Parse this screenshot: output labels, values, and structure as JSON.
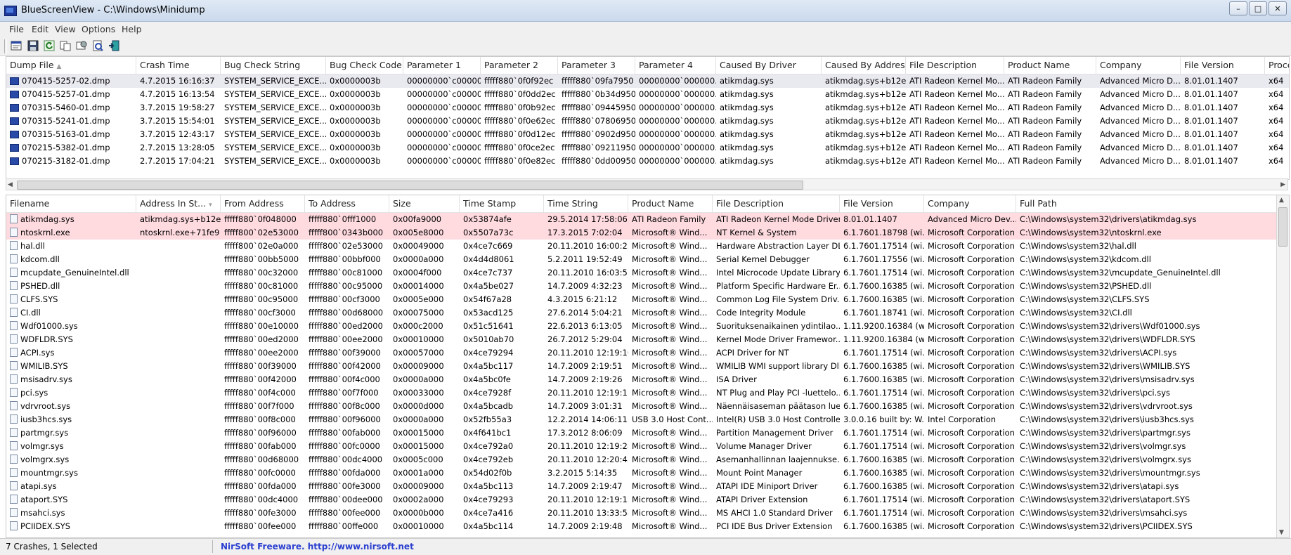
{
  "window": {
    "title": "BlueScreenView  -  C:\\Windows\\Minidump"
  },
  "menu": [
    "File",
    "Edit",
    "View",
    "Options",
    "Help"
  ],
  "toolbar": [
    "properties-icon",
    "save-icon",
    "refresh-icon",
    "copy-icon",
    "options-icon",
    "report-icon",
    "exit-icon"
  ],
  "top": {
    "columns": [
      "Dump File",
      "Crash Time",
      "Bug Check String",
      "Bug Check Code",
      "Parameter 1",
      "Parameter 2",
      "Parameter 3",
      "Parameter 4",
      "Caused By Driver",
      "Caused By Address",
      "File Description",
      "Product Name",
      "Company",
      "File Version",
      "Processor"
    ],
    "rows": [
      [
        "070415-5257-02.dmp",
        "4.7.2015 16:16:37",
        "SYSTEM_SERVICE_EXCE...",
        "0x0000003b",
        "00000000`c00000...",
        "fffff880`0f0f92ec",
        "fffff880`09fa7950",
        "00000000`000000...",
        "atikmdag.sys",
        "atikmdag.sys+b12ec",
        "ATI Radeon Kernel Mo...",
        "ATI Radeon Family",
        "Advanced Micro D...",
        "8.01.01.1407",
        "x64"
      ],
      [
        "070415-5257-01.dmp",
        "4.7.2015 16:13:54",
        "SYSTEM_SERVICE_EXCE...",
        "0x0000003b",
        "00000000`c00000...",
        "fffff880`0f0dd2ec",
        "fffff880`0b34d950",
        "00000000`000000...",
        "atikmdag.sys",
        "atikmdag.sys+b12ec",
        "ATI Radeon Kernel Mo...",
        "ATI Radeon Family",
        "Advanced Micro D...",
        "8.01.01.1407",
        "x64"
      ],
      [
        "070315-5460-01.dmp",
        "3.7.2015 19:58:27",
        "SYSTEM_SERVICE_EXCE...",
        "0x0000003b",
        "00000000`c00000...",
        "fffff880`0f0b92ec",
        "fffff880`09445950",
        "00000000`000000...",
        "atikmdag.sys",
        "atikmdag.sys+b12ec",
        "ATI Radeon Kernel Mo...",
        "ATI Radeon Family",
        "Advanced Micro D...",
        "8.01.01.1407",
        "x64"
      ],
      [
        "070315-5241-01.dmp",
        "3.7.2015 15:54:01",
        "SYSTEM_SERVICE_EXCE...",
        "0x0000003b",
        "00000000`c00000...",
        "fffff880`0f0e62ec",
        "fffff880`07806950",
        "00000000`000000...",
        "atikmdag.sys",
        "atikmdag.sys+b12ec",
        "ATI Radeon Kernel Mo...",
        "ATI Radeon Family",
        "Advanced Micro D...",
        "8.01.01.1407",
        "x64"
      ],
      [
        "070315-5163-01.dmp",
        "3.7.2015 12:43:17",
        "SYSTEM_SERVICE_EXCE...",
        "0x0000003b",
        "00000000`c00000...",
        "fffff880`0f0d12ec",
        "fffff880`0902d950",
        "00000000`000000...",
        "atikmdag.sys",
        "atikmdag.sys+b12ec",
        "ATI Radeon Kernel Mo...",
        "ATI Radeon Family",
        "Advanced Micro D...",
        "8.01.01.1407",
        "x64"
      ],
      [
        "070215-5382-01.dmp",
        "2.7.2015 13:28:05",
        "SYSTEM_SERVICE_EXCE...",
        "0x0000003b",
        "00000000`c00000...",
        "fffff880`0f0ce2ec",
        "fffff880`09211950",
        "00000000`000000...",
        "atikmdag.sys",
        "atikmdag.sys+b12ec",
        "ATI Radeon Kernel Mo...",
        "ATI Radeon Family",
        "Advanced Micro D...",
        "8.01.01.1407",
        "x64"
      ],
      [
        "070215-3182-01.dmp",
        "2.7.2015 17:04:21",
        "SYSTEM_SERVICE_EXCE...",
        "0x0000003b",
        "00000000`c00000...",
        "fffff880`0f0e82ec",
        "fffff880`0dd00950",
        "00000000`000000...",
        "atikmdag.sys",
        "atikmdag.sys+b12ec",
        "ATI Radeon Kernel Mo...",
        "ATI Radeon Family",
        "Advanced Micro D...",
        "8.01.01.1407",
        "x64"
      ]
    ]
  },
  "bottom": {
    "columns": [
      "Filename",
      "Address In St...",
      "From Address",
      "To Address",
      "Size",
      "Time Stamp",
      "Time String",
      "Product Name",
      "File Description",
      "File Version",
      "Company",
      "Full Path"
    ],
    "rows": [
      [
        "atikmdag.sys",
        "atikmdag.sys+b12ec",
        "fffff880`0f048000",
        "fffff880`0fff1000",
        "0x00fa9000",
        "0x53874afe",
        "29.5.2014 17:58:06",
        "ATI Radeon Family",
        "ATI Radeon Kernel Mode Driver",
        "8.01.01.1407",
        "Advanced Micro Dev...",
        "C:\\Windows\\system32\\drivers\\atikmdag.sys"
      ],
      [
        "ntoskrnl.exe",
        "ntoskrnl.exe+71fe9",
        "fffff800`02e53000",
        "fffff800`0343b000",
        "0x005e8000",
        "0x5507a73c",
        "17.3.2015 7:02:04",
        "Microsoft® Wind...",
        "NT Kernel & System",
        "6.1.7601.18798 (wi...",
        "Microsoft Corporation",
        "C:\\Windows\\system32\\ntoskrnl.exe"
      ],
      [
        "hal.dll",
        "",
        "fffff800`02e0a000",
        "fffff800`02e53000",
        "0x00049000",
        "0x4ce7c669",
        "20.11.2010 16:00:25",
        "Microsoft® Wind...",
        "Hardware Abstraction Layer DLL",
        "6.1.7601.17514 (wi...",
        "Microsoft Corporation",
        "C:\\Windows\\system32\\hal.dll"
      ],
      [
        "kdcom.dll",
        "",
        "fffff880`00bb5000",
        "fffff880`00bbf000",
        "0x0000a000",
        "0x4d4d8061",
        "5.2.2011 19:52:49",
        "Microsoft® Wind...",
        "Serial Kernel Debugger",
        "6.1.7601.17556 (wi...",
        "Microsoft Corporation",
        "C:\\Windows\\system32\\kdcom.dll"
      ],
      [
        "mcupdate_GenuineIntel.dll",
        "",
        "fffff880`00c32000",
        "fffff880`00c81000",
        "0x0004f000",
        "0x4ce7c737",
        "20.11.2010 16:03:51",
        "Microsoft® Wind...",
        "Intel Microcode Update Library",
        "6.1.7601.17514 (wi...",
        "Microsoft Corporation",
        "C:\\Windows\\system32\\mcupdate_GenuineIntel.dll"
      ],
      [
        "PSHED.dll",
        "",
        "fffff880`00c81000",
        "fffff880`00c95000",
        "0x00014000",
        "0x4a5be027",
        "14.7.2009 4:32:23",
        "Microsoft® Wind...",
        "Platform Specific Hardware Er...",
        "6.1.7600.16385 (wi...",
        "Microsoft Corporation",
        "C:\\Windows\\system32\\PSHED.dll"
      ],
      [
        "CLFS.SYS",
        "",
        "fffff880`00c95000",
        "fffff880`00cf3000",
        "0x0005e000",
        "0x54f67a28",
        "4.3.2015 6:21:12",
        "Microsoft® Wind...",
        "Common Log File System Driv...",
        "6.1.7600.16385 (wi...",
        "Microsoft Corporation",
        "C:\\Windows\\system32\\CLFS.SYS"
      ],
      [
        "CI.dll",
        "",
        "fffff880`00cf3000",
        "fffff880`00d68000",
        "0x00075000",
        "0x53acd125",
        "27.6.2014 5:04:21",
        "Microsoft® Wind...",
        "Code Integrity Module",
        "6.1.7601.18741 (wi...",
        "Microsoft Corporation",
        "C:\\Windows\\system32\\CI.dll"
      ],
      [
        "Wdf01000.sys",
        "",
        "fffff880`00e10000",
        "fffff880`00ed2000",
        "0x000c2000",
        "0x51c51641",
        "22.6.2013 6:13:05",
        "Microsoft® Wind...",
        "Suorituksenaikainen ydintilao...",
        "1.11.9200.16384 (w...",
        "Microsoft Corporation",
        "C:\\Windows\\system32\\drivers\\Wdf01000.sys"
      ],
      [
        "WDFLDR.SYS",
        "",
        "fffff880`00ed2000",
        "fffff880`00ee2000",
        "0x00010000",
        "0x5010ab70",
        "26.7.2012 5:29:04",
        "Microsoft® Wind...",
        "Kernel Mode Driver Framewor...",
        "1.11.9200.16384 (w...",
        "Microsoft Corporation",
        "C:\\Windows\\system32\\drivers\\WDFLDR.SYS"
      ],
      [
        "ACPI.sys",
        "",
        "fffff880`00ee2000",
        "fffff880`00f39000",
        "0x00057000",
        "0x4ce79294",
        "20.11.2010 12:19:16",
        "Microsoft® Wind...",
        "ACPI Driver for NT",
        "6.1.7601.17514 (wi...",
        "Microsoft Corporation",
        "C:\\Windows\\system32\\drivers\\ACPI.sys"
      ],
      [
        "WMILIB.SYS",
        "",
        "fffff880`00f39000",
        "fffff880`00f42000",
        "0x00009000",
        "0x4a5bc117",
        "14.7.2009 2:19:51",
        "Microsoft® Wind...",
        "WMILIB WMI support library Dll",
        "6.1.7600.16385 (wi...",
        "Microsoft Corporation",
        "C:\\Windows\\system32\\drivers\\WMILIB.SYS"
      ],
      [
        "msisadrv.sys",
        "",
        "fffff880`00f42000",
        "fffff880`00f4c000",
        "0x0000a000",
        "0x4a5bc0fe",
        "14.7.2009 2:19:26",
        "Microsoft® Wind...",
        "ISA Driver",
        "6.1.7600.16385 (wi...",
        "Microsoft Corporation",
        "C:\\Windows\\system32\\drivers\\msisadrv.sys"
      ],
      [
        "pci.sys",
        "",
        "fffff880`00f4c000",
        "fffff880`00f7f000",
        "0x00033000",
        "0x4ce7928f",
        "20.11.2010 12:19:11",
        "Microsoft® Wind...",
        "NT Plug and Play PCI -luettelo...",
        "6.1.7601.17514 (wi...",
        "Microsoft Corporation",
        "C:\\Windows\\system32\\drivers\\pci.sys"
      ],
      [
        "vdrvroot.sys",
        "",
        "fffff880`00f7f000",
        "fffff880`00f8c000",
        "0x0000d000",
        "0x4a5bcadb",
        "14.7.2009 3:01:31",
        "Microsoft® Wind...",
        "Näennäisaseman päätason lue...",
        "6.1.7600.16385 (wi...",
        "Microsoft Corporation",
        "C:\\Windows\\system32\\drivers\\vdrvroot.sys"
      ],
      [
        "iusb3hcs.sys",
        "",
        "fffff880`00f8c000",
        "fffff880`00f96000",
        "0x0000a000",
        "0x52fb55a3",
        "12.2.2014 14:06:11",
        "USB 3.0 Host Cont...",
        "Intel(R) USB 3.0 Host Controlle...",
        "3.0.0.16 built by: W...",
        "Intel Corporation",
        "C:\\Windows\\system32\\drivers\\iusb3hcs.sys"
      ],
      [
        "partmgr.sys",
        "",
        "fffff880`00f96000",
        "fffff880`00fab000",
        "0x00015000",
        "0x4f641bc1",
        "17.3.2012 8:06:09",
        "Microsoft® Wind...",
        "Partition Management Driver",
        "6.1.7601.17514 (wi...",
        "Microsoft Corporation",
        "C:\\Windows\\system32\\drivers\\partmgr.sys"
      ],
      [
        "volmgr.sys",
        "",
        "fffff880`00fab000",
        "fffff880`00fc0000",
        "0x00015000",
        "0x4ce792a0",
        "20.11.2010 12:19:28",
        "Microsoft® Wind...",
        "Volume Manager Driver",
        "6.1.7601.17514 (wi...",
        "Microsoft Corporation",
        "C:\\Windows\\system32\\drivers\\volmgr.sys"
      ],
      [
        "volmgrx.sys",
        "",
        "fffff880`00d68000",
        "fffff880`00dc4000",
        "0x0005c000",
        "0x4ce792eb",
        "20.11.2010 12:20:43",
        "Microsoft® Wind...",
        "Asemanhallinnan laajennukse...",
        "6.1.7600.16385 (wi...",
        "Microsoft Corporation",
        "C:\\Windows\\system32\\drivers\\volmgrx.sys"
      ],
      [
        "mountmgr.sys",
        "",
        "fffff880`00fc0000",
        "fffff880`00fda000",
        "0x0001a000",
        "0x54d02f0b",
        "3.2.2015 5:14:35",
        "Microsoft® Wind...",
        "Mount Point Manager",
        "6.1.7600.16385 (wi...",
        "Microsoft Corporation",
        "C:\\Windows\\system32\\drivers\\mountmgr.sys"
      ],
      [
        "atapi.sys",
        "",
        "fffff880`00fda000",
        "fffff880`00fe3000",
        "0x00009000",
        "0x4a5bc113",
        "14.7.2009 2:19:47",
        "Microsoft® Wind...",
        "ATAPI IDE Miniport Driver",
        "6.1.7600.16385 (wi...",
        "Microsoft Corporation",
        "C:\\Windows\\system32\\drivers\\atapi.sys"
      ],
      [
        "ataport.SYS",
        "",
        "fffff880`00dc4000",
        "fffff880`00dee000",
        "0x0002a000",
        "0x4ce79293",
        "20.11.2010 12:19:15",
        "Microsoft® Wind...",
        "ATAPI Driver Extension",
        "6.1.7601.17514 (wi...",
        "Microsoft Corporation",
        "C:\\Windows\\system32\\drivers\\ataport.SYS"
      ],
      [
        "msahci.sys",
        "",
        "fffff880`00fe3000",
        "fffff880`00fee000",
        "0x0000b000",
        "0x4ce7a416",
        "20.11.2010 13:33:58",
        "Microsoft® Wind...",
        "MS AHCI 1.0 Standard Driver",
        "6.1.7601.17514 (wi...",
        "Microsoft Corporation",
        "C:\\Windows\\system32\\drivers\\msahci.sys"
      ],
      [
        "PCIIDEX.SYS",
        "",
        "fffff880`00fee000",
        "fffff880`00ffe000",
        "0x00010000",
        "0x4a5bc114",
        "14.7.2009 2:19:48",
        "Microsoft® Wind...",
        "PCI IDE Bus Driver Extension",
        "6.1.7600.16385 (wi...",
        "Microsoft Corporation",
        "C:\\Windows\\system32\\drivers\\PCIIDEX.SYS"
      ]
    ]
  },
  "status": {
    "count": "7 Crashes, 1 Selected",
    "link": "NirSoft Freeware.  http://www.nirsoft.net"
  },
  "colors": {
    "highlight_row": "#ffdbe0",
    "selected_row": "#e9e9f0",
    "link": "#2b3fd0"
  }
}
